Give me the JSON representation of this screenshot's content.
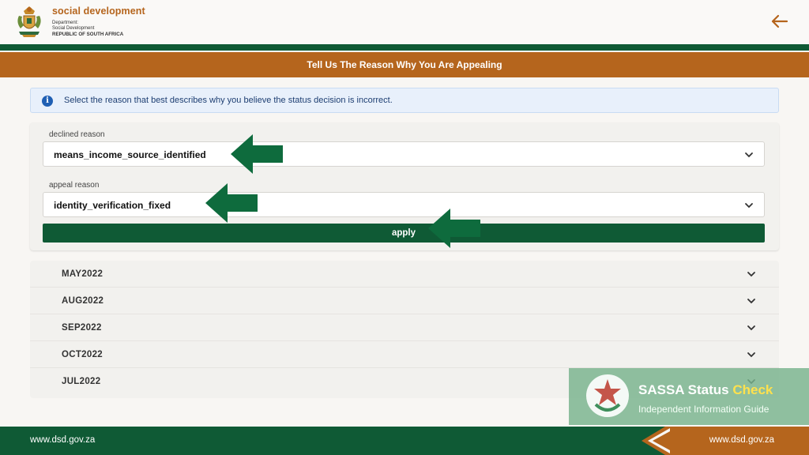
{
  "header": {
    "brand_name": "social development",
    "brand_line1": "Department:",
    "brand_line2": "Social Development",
    "brand_line3": "REPUBLIC OF SOUTH AFRICA",
    "back_icon": "arrow-left-icon"
  },
  "title_bar": {
    "text": "Tell Us The Reason Why You Are Appealing"
  },
  "info": {
    "icon": "info-icon",
    "text": "Select the reason that best describes why you believe the status decision is incorrect."
  },
  "form": {
    "declined_label": "declined reason",
    "declined_value": "means_income_source_identified",
    "appeal_label": "appeal reason",
    "appeal_value": "identity_verification_fixed",
    "apply_label": "apply"
  },
  "months": [
    "MAY2022",
    "AUG2022",
    "SEP2022",
    "OCT2022",
    "JUL2022"
  ],
  "watermark": {
    "title_part1": "SASSA Status ",
    "title_part2": "Check",
    "subtitle": "Independent Information Guide"
  },
  "footer": {
    "url_left": "www.dsd.gov.za",
    "url_right": "www.dsd.gov.za"
  },
  "colors": {
    "green": "#0f5a35",
    "orange": "#b5651d",
    "info_bg": "#e8f0fb",
    "arrow_green": "#0e6b3d"
  }
}
